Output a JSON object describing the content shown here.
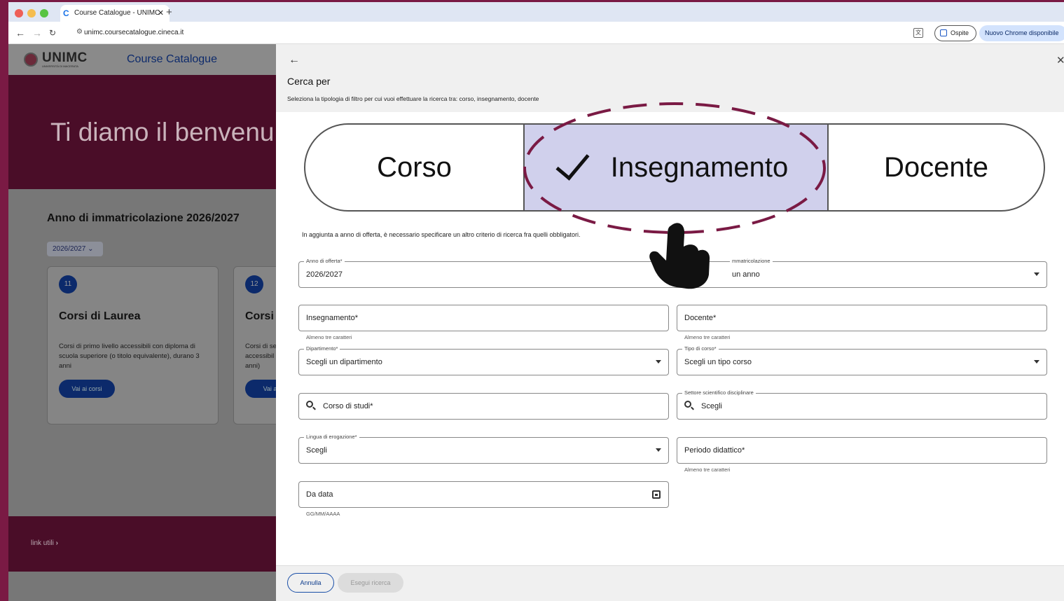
{
  "browser": {
    "tab_title": "Course Catalogue - UNIMC",
    "url": "unimc.coursecatalogue.cineca.it",
    "guest_label": "Ospite",
    "update_label": "Nuovo Chrome disponibile"
  },
  "site": {
    "logo": "UNIMC",
    "logo_sub": "UNIVERSITÀ DI MACERATA",
    "header_title": "Course Catalogue",
    "hero_text": "Ti diamo il benvenu",
    "section_title": "Anno di immatricolazione 2026/2027",
    "year_select": "2026/2027",
    "cards": [
      {
        "num": "11",
        "title": "Corsi di Laurea",
        "desc": "Corsi di primo livello accessibili con diploma di scuola superiore (o titolo equivalente), durano 3 anni",
        "button": "Vai ai corsi"
      },
      {
        "num": "12",
        "title": "Corsi",
        "desc": "Corsi di se accessibil anni)",
        "button": "Vai ai c"
      }
    ],
    "footer_link": "link utili"
  },
  "drawer": {
    "title": "Cerca per",
    "subtitle": "Seleziona la tipologia di filtro per cui vuoi effettuare la ricerca tra: corso, insegnamento, docente",
    "segments": [
      "Corso",
      "Insegnamento",
      "Docente"
    ],
    "selected_segment": "Insegnamento",
    "hint": "In aggiunta a anno di offerta, è necessario specificare un altro criterio di ricerca fra quelli obbligatori.",
    "fields": {
      "anno_offerta": {
        "label": "Anno di offerta*",
        "value": "2026/2027"
      },
      "anno_immatricolazione": {
        "label": "mmatricolazione",
        "value": "un anno"
      },
      "insegnamento": {
        "placeholder": "Insegnamento*",
        "helper": "Almeno tre caratteri"
      },
      "docente": {
        "placeholder": "Docente*",
        "helper": "Almeno tre caratteri"
      },
      "dipartimento": {
        "label": "Dipartimento*",
        "value": "Scegli un dipartimento"
      },
      "tipo_corso": {
        "label": "Tipo di corso*",
        "value": "Scegli un tipo corso"
      },
      "corso_studi": {
        "placeholder": "Corso di studi*"
      },
      "settore": {
        "label": "Settore scientifico disciplinare",
        "value": "Scegli"
      },
      "lingua": {
        "label": "Lingua di erogazione*",
        "value": "Scegli"
      },
      "periodo": {
        "placeholder": "Periodo didattico*",
        "helper": "Almeno tre caratteri"
      },
      "da_data": {
        "placeholder": "Da data",
        "helper": "GG/MM/AAAA"
      }
    },
    "buttons": {
      "cancel": "Annulla",
      "search": "Esegui ricerca"
    }
  },
  "colors": {
    "accent_frame": "#7a1a44",
    "selected_segment": "#d0d0ec",
    "primary": "#0c2a6b"
  },
  "icons": [
    "back-arrow-icon",
    "close-icon",
    "check-icon",
    "search-icon",
    "calendar-icon",
    "chevron-down-icon",
    "pointer-hand-icon"
  ]
}
